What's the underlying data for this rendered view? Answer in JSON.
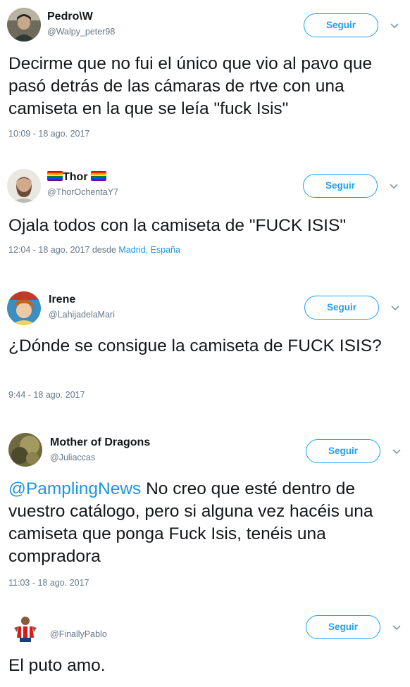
{
  "follow_label": "Seguir",
  "tweets": [
    {
      "name": "Pedro\\W",
      "handle": "@Walpy_peter98",
      "text": "Decirme que no fui el único que vio al pavo que pasó detrás de las cámaras de rtve con una camiseta en la que se leía \"fuck Isis\"",
      "timestamp": "10:09 - 18 ago. 2017"
    },
    {
      "name": "Thor",
      "name_decoration": "rainbow-flag-emoji",
      "handle": "@ThorOchentaY7",
      "text": "Ojala todos con la camiseta de \"FUCK ISIS\"",
      "timestamp": "12:04 - 18 ago. 2017 desde ",
      "location": "Madrid, España"
    },
    {
      "name": "Irene",
      "handle": "@LahijadelaMari",
      "text": "¿Dónde se consigue la camiseta de FUCK ISIS?",
      "timestamp": "9:44 - 18 ago. 2017"
    },
    {
      "name": "Mother of Dragons",
      "handle": "@Juliaccas",
      "mention": "@PamplingNews",
      "text": " No creo que esté dentro de vuestro catálogo, pero si alguna vez hacéis una camiseta que ponga Fuck Isis, tenéis una compradora",
      "timestamp": "11:03 - 18 ago. 2017"
    },
    {
      "name": "",
      "handle": "@FinallyPablo",
      "text": "El puto amo."
    }
  ],
  "colors": {
    "accent": "#1da1f2",
    "link": "#1b95e0",
    "muted": "#657786",
    "text": "#14171a"
  },
  "icons": [
    "chevron-down-icon",
    "rainbow-flag-emoji"
  ]
}
